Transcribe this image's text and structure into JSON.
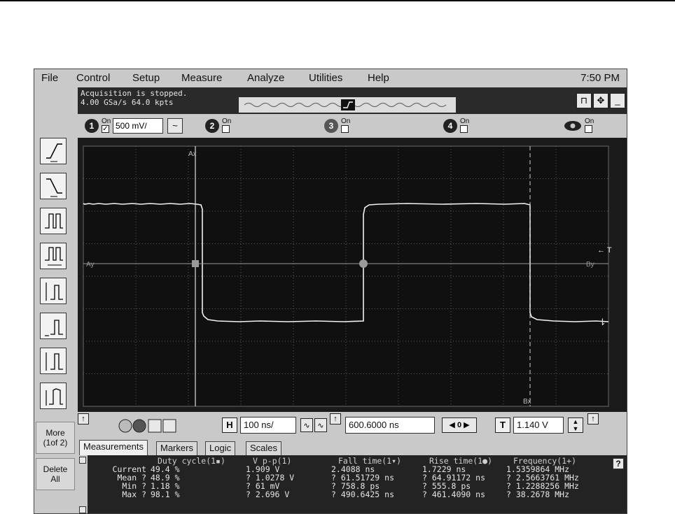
{
  "menu": {
    "items": [
      "File",
      "Control",
      "Setup",
      "Measure",
      "Analyze",
      "Utilities",
      "Help"
    ],
    "clock": "7:50 PM"
  },
  "status": {
    "line1": "Acquisition is stopped.",
    "line2": "4.00 GSa/s   64.0 kpts"
  },
  "channels": {
    "on_label": "On",
    "ch1": {
      "number": "1",
      "checked": "✓",
      "scale": "500 mV/",
      "coupling": "~"
    },
    "ch2": {
      "number": "2"
    },
    "ch3": {
      "number": "3"
    },
    "ch4": {
      "number": "4"
    }
  },
  "left_panel": {
    "more_label_1": "More",
    "more_label_2": "(1of 2)",
    "delete_label_1": "Delete",
    "delete_label_2": "All"
  },
  "scope": {
    "cursor_a_label": "Ax",
    "cursor_a_y_label": "Ay",
    "cursor_b_label": "Bx",
    "cursor_b_y_label": "By",
    "trigger_label": "← T",
    "ground_marker": "⇂",
    "trace_color": "#f2f2f2",
    "grid_color": "#5a5a5a"
  },
  "horizontal": {
    "h_button": "H",
    "timebase": "100 ns/",
    "delay": "600.6000 ns",
    "nav_value": "0",
    "t_button": "T",
    "trigger_level": "1.140 V"
  },
  "tabs": [
    "Measurements",
    "Markers",
    "Logic",
    "Scales"
  ],
  "measurements": {
    "row_labels": [
      "Current",
      "Mean ?",
      "Min ?",
      "Max ?"
    ],
    "columns": [
      {
        "header": "Duty cycle(1▪)",
        "values": [
          "49.4 %",
          "48.9 %",
          "1.18 %",
          "98.1 %"
        ]
      },
      {
        "header": "V p-p(1)",
        "values": [
          "1.909 V",
          "? 1.0278 V",
          "? 61 mV",
          "? 2.696 V"
        ]
      },
      {
        "header": "Fall time(1▾)",
        "values": [
          "2.4088 ns",
          "? 61.51729 ns",
          "? 758.8 ps",
          "? 490.6425 ns"
        ]
      },
      {
        "header": "Rise time(1●)",
        "values": [
          "1.7229 ns",
          "? 64.91172 ns",
          "? 555.8 ps",
          "? 461.4090 ns"
        ]
      },
      {
        "header": "Frequency(1+)",
        "values": [
          "1.5359864 MHz",
          "? 2.5663761 MHz",
          "? 1.2288256 MHz",
          "? 38.2678 MHz"
        ]
      }
    ],
    "help": "?"
  }
}
